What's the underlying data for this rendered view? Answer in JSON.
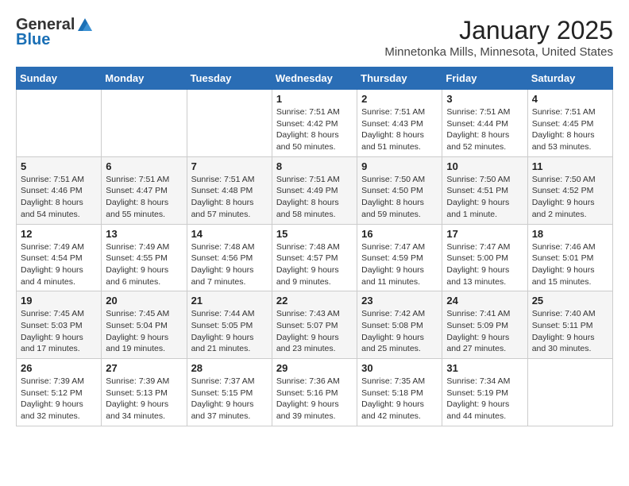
{
  "header": {
    "logo_general": "General",
    "logo_blue": "Blue",
    "month_title": "January 2025",
    "location": "Minnetonka Mills, Minnesota, United States"
  },
  "weekdays": [
    "Sunday",
    "Monday",
    "Tuesday",
    "Wednesday",
    "Thursday",
    "Friday",
    "Saturday"
  ],
  "weeks": [
    [
      {
        "day": "",
        "info": ""
      },
      {
        "day": "",
        "info": ""
      },
      {
        "day": "",
        "info": ""
      },
      {
        "day": "1",
        "info": "Sunrise: 7:51 AM\nSunset: 4:42 PM\nDaylight: 8 hours\nand 50 minutes."
      },
      {
        "day": "2",
        "info": "Sunrise: 7:51 AM\nSunset: 4:43 PM\nDaylight: 8 hours\nand 51 minutes."
      },
      {
        "day": "3",
        "info": "Sunrise: 7:51 AM\nSunset: 4:44 PM\nDaylight: 8 hours\nand 52 minutes."
      },
      {
        "day": "4",
        "info": "Sunrise: 7:51 AM\nSunset: 4:45 PM\nDaylight: 8 hours\nand 53 minutes."
      }
    ],
    [
      {
        "day": "5",
        "info": "Sunrise: 7:51 AM\nSunset: 4:46 PM\nDaylight: 8 hours\nand 54 minutes."
      },
      {
        "day": "6",
        "info": "Sunrise: 7:51 AM\nSunset: 4:47 PM\nDaylight: 8 hours\nand 55 minutes."
      },
      {
        "day": "7",
        "info": "Sunrise: 7:51 AM\nSunset: 4:48 PM\nDaylight: 8 hours\nand 57 minutes."
      },
      {
        "day": "8",
        "info": "Sunrise: 7:51 AM\nSunset: 4:49 PM\nDaylight: 8 hours\nand 58 minutes."
      },
      {
        "day": "9",
        "info": "Sunrise: 7:50 AM\nSunset: 4:50 PM\nDaylight: 8 hours\nand 59 minutes."
      },
      {
        "day": "10",
        "info": "Sunrise: 7:50 AM\nSunset: 4:51 PM\nDaylight: 9 hours\nand 1 minute."
      },
      {
        "day": "11",
        "info": "Sunrise: 7:50 AM\nSunset: 4:52 PM\nDaylight: 9 hours\nand 2 minutes."
      }
    ],
    [
      {
        "day": "12",
        "info": "Sunrise: 7:49 AM\nSunset: 4:54 PM\nDaylight: 9 hours\nand 4 minutes."
      },
      {
        "day": "13",
        "info": "Sunrise: 7:49 AM\nSunset: 4:55 PM\nDaylight: 9 hours\nand 6 minutes."
      },
      {
        "day": "14",
        "info": "Sunrise: 7:48 AM\nSunset: 4:56 PM\nDaylight: 9 hours\nand 7 minutes."
      },
      {
        "day": "15",
        "info": "Sunrise: 7:48 AM\nSunset: 4:57 PM\nDaylight: 9 hours\nand 9 minutes."
      },
      {
        "day": "16",
        "info": "Sunrise: 7:47 AM\nSunset: 4:59 PM\nDaylight: 9 hours\nand 11 minutes."
      },
      {
        "day": "17",
        "info": "Sunrise: 7:47 AM\nSunset: 5:00 PM\nDaylight: 9 hours\nand 13 minutes."
      },
      {
        "day": "18",
        "info": "Sunrise: 7:46 AM\nSunset: 5:01 PM\nDaylight: 9 hours\nand 15 minutes."
      }
    ],
    [
      {
        "day": "19",
        "info": "Sunrise: 7:45 AM\nSunset: 5:03 PM\nDaylight: 9 hours\nand 17 minutes."
      },
      {
        "day": "20",
        "info": "Sunrise: 7:45 AM\nSunset: 5:04 PM\nDaylight: 9 hours\nand 19 minutes."
      },
      {
        "day": "21",
        "info": "Sunrise: 7:44 AM\nSunset: 5:05 PM\nDaylight: 9 hours\nand 21 minutes."
      },
      {
        "day": "22",
        "info": "Sunrise: 7:43 AM\nSunset: 5:07 PM\nDaylight: 9 hours\nand 23 minutes."
      },
      {
        "day": "23",
        "info": "Sunrise: 7:42 AM\nSunset: 5:08 PM\nDaylight: 9 hours\nand 25 minutes."
      },
      {
        "day": "24",
        "info": "Sunrise: 7:41 AM\nSunset: 5:09 PM\nDaylight: 9 hours\nand 27 minutes."
      },
      {
        "day": "25",
        "info": "Sunrise: 7:40 AM\nSunset: 5:11 PM\nDaylight: 9 hours\nand 30 minutes."
      }
    ],
    [
      {
        "day": "26",
        "info": "Sunrise: 7:39 AM\nSunset: 5:12 PM\nDaylight: 9 hours\nand 32 minutes."
      },
      {
        "day": "27",
        "info": "Sunrise: 7:39 AM\nSunset: 5:13 PM\nDaylight: 9 hours\nand 34 minutes."
      },
      {
        "day": "28",
        "info": "Sunrise: 7:37 AM\nSunset: 5:15 PM\nDaylight: 9 hours\nand 37 minutes."
      },
      {
        "day": "29",
        "info": "Sunrise: 7:36 AM\nSunset: 5:16 PM\nDaylight: 9 hours\nand 39 minutes."
      },
      {
        "day": "30",
        "info": "Sunrise: 7:35 AM\nSunset: 5:18 PM\nDaylight: 9 hours\nand 42 minutes."
      },
      {
        "day": "31",
        "info": "Sunrise: 7:34 AM\nSunset: 5:19 PM\nDaylight: 9 hours\nand 44 minutes."
      },
      {
        "day": "",
        "info": ""
      }
    ]
  ]
}
